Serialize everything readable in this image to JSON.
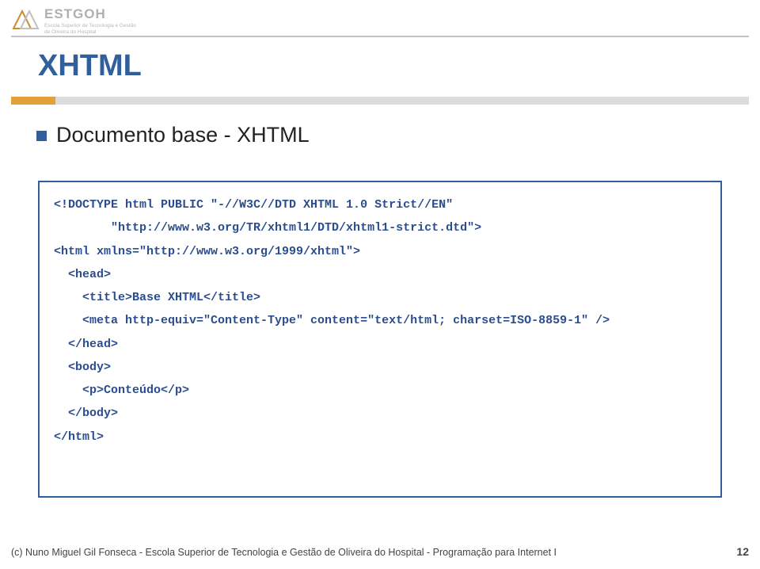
{
  "logo": {
    "title": "ESTGOH",
    "sub1": "Escola Superior de Tecnologia e Gestão",
    "sub2": "de Oliveira do Hospital"
  },
  "slide": {
    "title": "XHTML",
    "bullet": "Documento base - XHTML"
  },
  "code": {
    "l1": "<!DOCTYPE html PUBLIC \"-//W3C//DTD XHTML 1.0 Strict//EN\"",
    "l2": "        \"http://www.w3.org/TR/xhtml1/DTD/xhtml1-strict.dtd\">",
    "l3": "<html xmlns=\"http://www.w3.org/1999/xhtml\">",
    "l4": "  <head>",
    "l5": "    <title>Base XHTML</title>",
    "l6": "    <meta http-equiv=\"Content-Type\" content=\"text/html; charset=ISO-8859-1\" />",
    "l7": "  </head>",
    "l8": "  <body>",
    "l9": "    <p>Conteúdo</p>",
    "l10": "  </body>",
    "l11": "</html>"
  },
  "footer": {
    "left": "(c) Nuno Miguel Gil Fonseca  -  Escola Superior de Tecnologia e Gestão de Oliveira do Hospital  -  Programação para Internet I",
    "right": "12"
  }
}
